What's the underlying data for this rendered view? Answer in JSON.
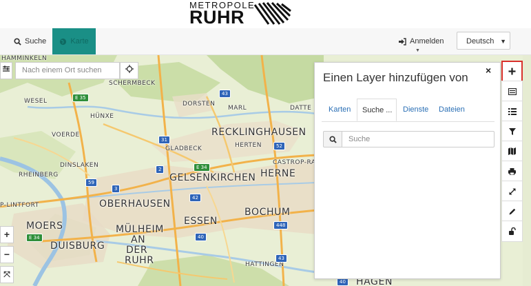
{
  "header": {
    "logo_top": "METROPOLE",
    "logo_main": "RUHR"
  },
  "nav": {
    "search_label": "Suche",
    "map_label": "Karte",
    "login_label": "Anmelden",
    "language_value": "Deutsch",
    "accent_color": "#1a8f86"
  },
  "map_search": {
    "placeholder": "Nach einem Ort suchen"
  },
  "zoom": {
    "in": "+",
    "out": "−",
    "fullscreen": "⤧"
  },
  "map": {
    "cities": [
      {
        "name": "HAMMINKELN",
        "size": "sml"
      },
      {
        "name": "SCHERMBECK",
        "size": "sml"
      },
      {
        "name": "WESEL",
        "size": "sml"
      },
      {
        "name": "DORSTEN",
        "size": "sml"
      },
      {
        "name": "MARL",
        "size": "sml"
      },
      {
        "name": "DATTE",
        "size": "sml"
      },
      {
        "name": "HÜNXE",
        "size": "sml"
      },
      {
        "name": "VOERDE",
        "size": "sml"
      },
      {
        "name": "RECKLINGHAUSEN",
        "size": "big"
      },
      {
        "name": "HERTEN",
        "size": "sml"
      },
      {
        "name": "GLADBECK",
        "size": "sml"
      },
      {
        "name": "DINSLAKEN",
        "size": "sml"
      },
      {
        "name": "CASTROP-RA",
        "size": "sml"
      },
      {
        "name": "RHEINBERG",
        "size": "sml"
      },
      {
        "name": "GELSENKIRCHEN",
        "size": "big"
      },
      {
        "name": "HERNE",
        "size": "big"
      },
      {
        "name": "P-LINTFORT",
        "size": "sml"
      },
      {
        "name": "OBERHAUSEN",
        "size": "big"
      },
      {
        "name": "BOCHUM",
        "size": "big"
      },
      {
        "name": "MOERS",
        "size": "big"
      },
      {
        "name": "ESSEN",
        "size": "big"
      },
      {
        "name": "MÜLHEIM",
        "size": "big"
      },
      {
        "name": "AN",
        "size": "big"
      },
      {
        "name": "DER",
        "size": "big"
      },
      {
        "name": "RUHR",
        "size": "big"
      },
      {
        "name": "DUISBURG",
        "size": "big"
      },
      {
        "name": "HATTINGEN",
        "size": "sml"
      },
      {
        "name": "HAGEN",
        "size": "big"
      }
    ],
    "shields": [
      "E 35",
      "31",
      "43",
      "52",
      "2",
      "E 34",
      "59",
      "3",
      "42",
      "40",
      "448",
      "43",
      "E 34",
      "40"
    ]
  },
  "panel": {
    "title": "Einen Layer hinzufügen von",
    "close": "×",
    "tabs": [
      "Karten",
      "Suche ...",
      "Dienste",
      "Dateien"
    ],
    "active_tab": "Suche ...",
    "search_placeholder": "Suche"
  },
  "toolbar": {
    "tools": [
      "add-layer",
      "layer-catalog",
      "legend",
      "filter",
      "map",
      "print",
      "measure",
      "draw",
      "unlock"
    ],
    "highlight_color": "#d9302c"
  }
}
